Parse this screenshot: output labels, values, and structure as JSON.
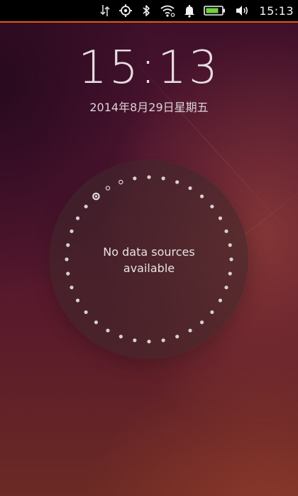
{
  "status_bar": {
    "icons": [
      "data-transfer-icon",
      "location-icon",
      "bluetooth-icon",
      "wifi-icon",
      "notification-bell-icon",
      "battery-icon",
      "volume-icon"
    ],
    "time": "15:13",
    "accent_color": "#e95420",
    "battery_color": "#6fd13f"
  },
  "lockscreen": {
    "clock": "15:13",
    "date": "2014年8月29日星期五"
  },
  "infographic": {
    "message": "No data sources available"
  }
}
